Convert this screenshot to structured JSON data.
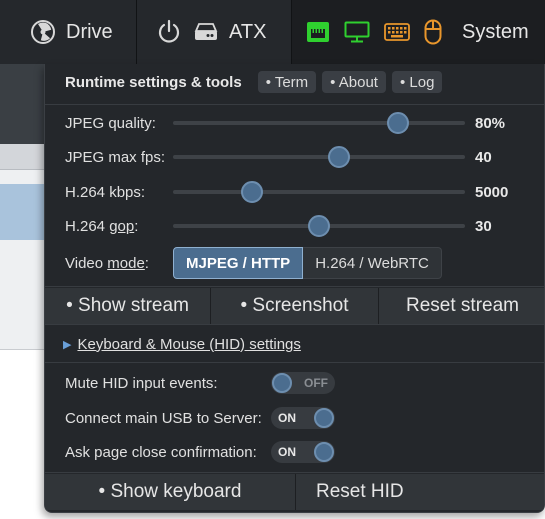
{
  "navbar": {
    "drive_label": "Drive",
    "atx_label": "ATX",
    "system_label": "System",
    "icons": [
      "drive-icon",
      "power-icon",
      "hdd-icon",
      "ethernet-icon",
      "monitor-icon",
      "keyboard-icon",
      "mouse-icon"
    ],
    "colors": {
      "green": "#2fd02f",
      "orange": "#e8962c"
    }
  },
  "menu": {
    "title": "Runtime settings & tools",
    "header_buttons": [
      "• Term",
      "• About",
      "• Log"
    ],
    "sliders": [
      {
        "label": "JPEG quality:",
        "value": "80%",
        "fraction": 0.77
      },
      {
        "label": "JPEG max fps:",
        "value": "40",
        "fraction": 0.57
      },
      {
        "label": "H.264 kbps:",
        "value": "5000",
        "fraction": 0.27
      },
      {
        "label_prefix": "H.264 ",
        "label_under": "gop",
        "label_suffix": ":",
        "value": "30",
        "fraction": 0.5
      }
    ],
    "video_mode": {
      "label_prefix": "Video ",
      "label_under": "mode",
      "label_suffix": ":",
      "options": [
        "MJPEG / HTTP",
        "H.264 / WebRTC"
      ],
      "selected": "MJPEG / HTTP"
    },
    "stream_buttons": [
      "• Show stream",
      "• Screenshot",
      "Reset stream"
    ],
    "hid_link": "Keyboard & Mouse (HID) settings",
    "toggles": [
      {
        "label": "Mute HID input events:",
        "state": "OFF"
      },
      {
        "label": "Connect main USB to Server:",
        "state": "ON"
      },
      {
        "label": "Ask page close confirmation:",
        "state": "ON"
      }
    ],
    "bottom_buttons": [
      "• Show keyboard",
      "Reset HID"
    ]
  }
}
